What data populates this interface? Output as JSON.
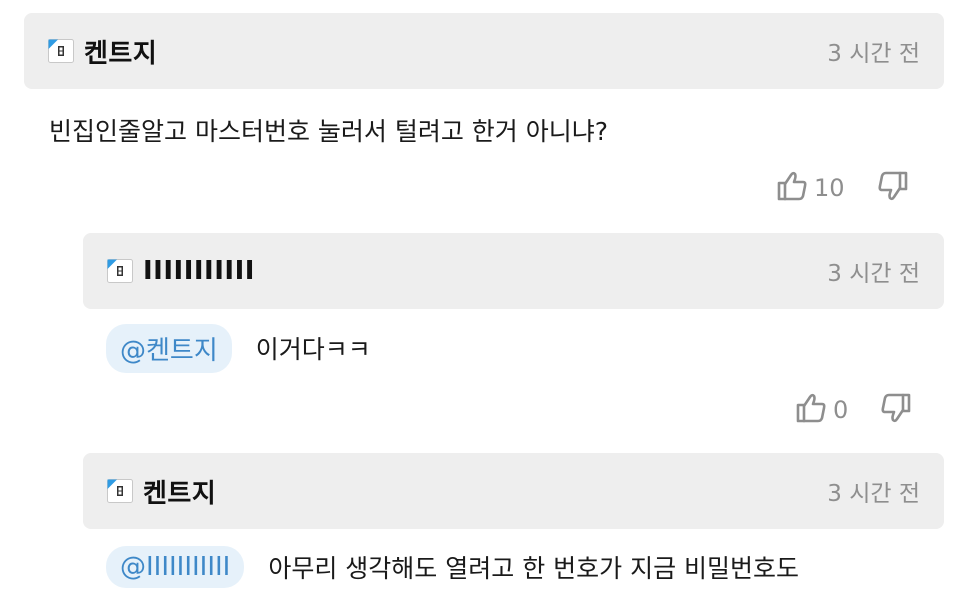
{
  "comments": [
    {
      "author": "켄트지",
      "time": "3 시간 전",
      "text": "빈집인줄알고 마스터번호 눌러서 털려고 한거 아니냐?",
      "likes": "10"
    },
    {
      "author": "IIIIIIIIIII",
      "time": "3 시간 전",
      "mention": "@켄트지",
      "text": "이거다ㅋㅋ",
      "likes": "0"
    },
    {
      "author": "켄트지",
      "time": "3 시간 전",
      "mention": "@IIIIIIIIIII",
      "text": "아무리 생각해도 열려고 한 번호가 지금 비밀번호도"
    }
  ],
  "icons": {
    "level_badge": "level-badge-icon",
    "like": "thumbs-up-icon",
    "dislike": "thumbs-down-icon"
  },
  "colors": {
    "header_bg": "#eeeeee",
    "mention_bg": "#e6f1fa",
    "mention_text": "#3e88c8",
    "muted": "#8e8e8e"
  }
}
